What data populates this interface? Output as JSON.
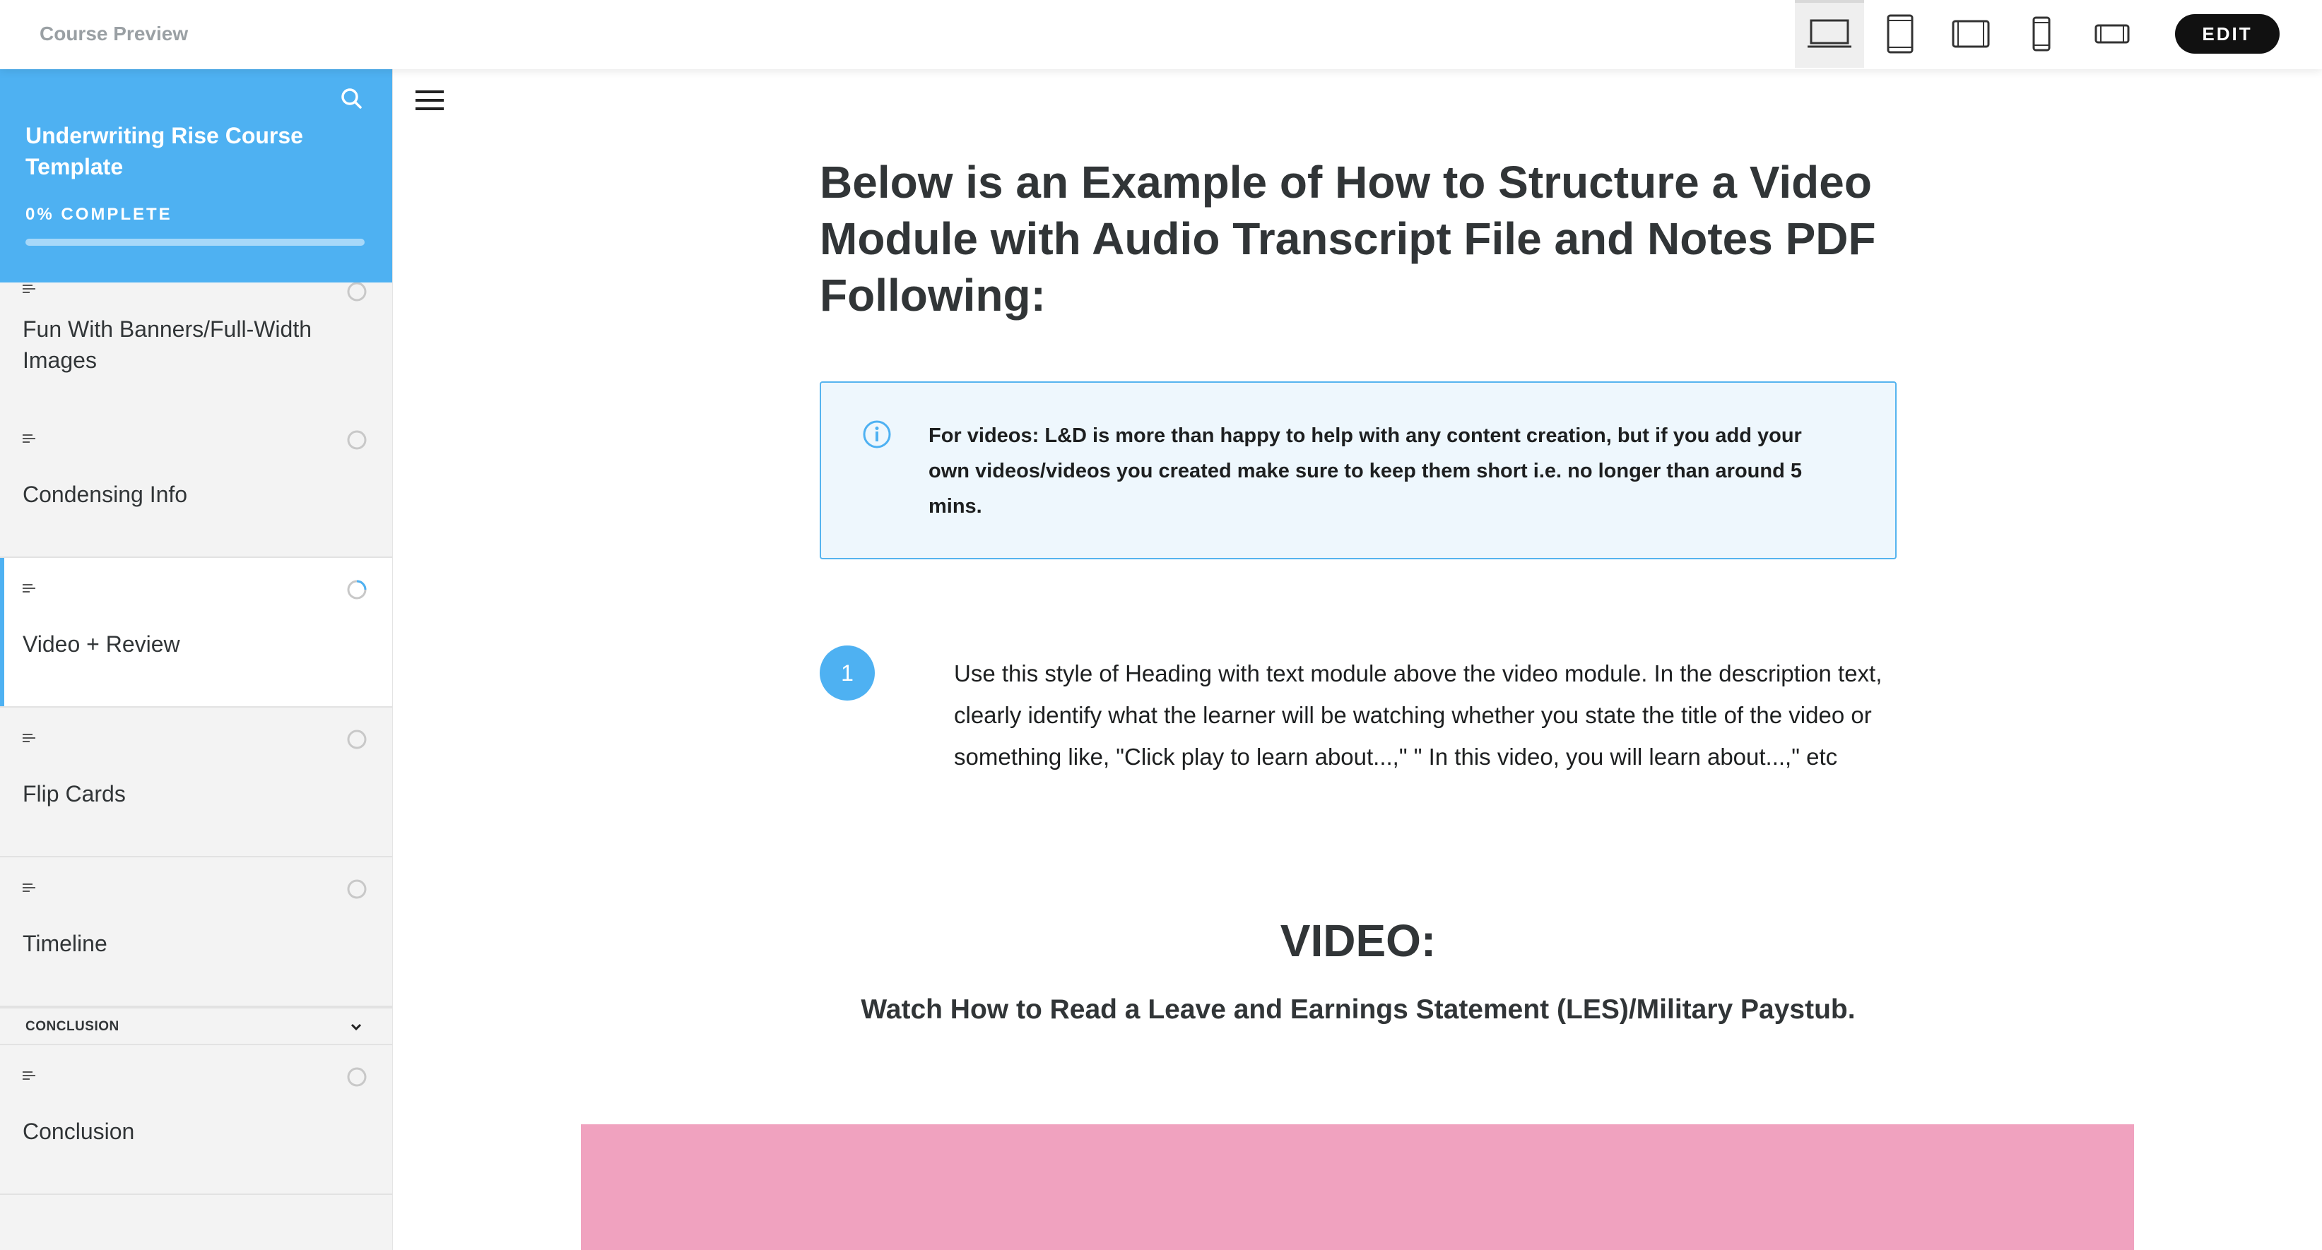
{
  "topbar": {
    "title": "Course Preview",
    "devices": [
      {
        "name": "desktop",
        "active": true
      },
      {
        "name": "tablet-portrait",
        "active": false
      },
      {
        "name": "tablet-landscape",
        "active": false
      },
      {
        "name": "phone-portrait",
        "active": false
      },
      {
        "name": "phone-landscape",
        "active": false
      }
    ],
    "edit_label": "EDIT"
  },
  "sidebar": {
    "course_title": "Underwriting Rise Course Template",
    "progress_label": "0% COMPLETE",
    "progress_fraction": 0,
    "lessons": [
      {
        "title": "Fun With Banners/Full-Width Images",
        "status": "not-started"
      },
      {
        "title": "Condensing Info",
        "status": "not-started"
      },
      {
        "title": "Video + Review",
        "status": "in-progress"
      },
      {
        "title": "Flip Cards",
        "status": "not-started"
      },
      {
        "title": "Timeline",
        "status": "not-started"
      }
    ],
    "section": {
      "label": "CONCLUSION",
      "lessons": [
        {
          "title": "Conclusion",
          "status": "not-started"
        }
      ]
    }
  },
  "main": {
    "heading": "Below is an Example of How to Structure a Video Module with Audio Transcript File and Notes PDF Following:",
    "note": {
      "label": "For videos:",
      "text": " L&D is more than happy to help with any content creation, but if you add your own videos/videos you created make sure to keep them short i.e. no longer than around 5 mins."
    },
    "step": {
      "number": "1",
      "text": "Use this style of Heading with text module above the video module. In the description text, clearly identify what the learner will be watching whether you state the title of the video or something like, \"Click play to learn about...,\" \" In this video, you will learn about...,\" etc"
    },
    "video_heading": "VIDEO:",
    "video_subheading": "Watch How to Read a Leave and Earnings Statement (LES)/Military Paystub."
  },
  "colors": {
    "accent": "#4eb1f2",
    "note_bg": "#eef7fd",
    "video_placeholder": "#f0a2bf"
  }
}
